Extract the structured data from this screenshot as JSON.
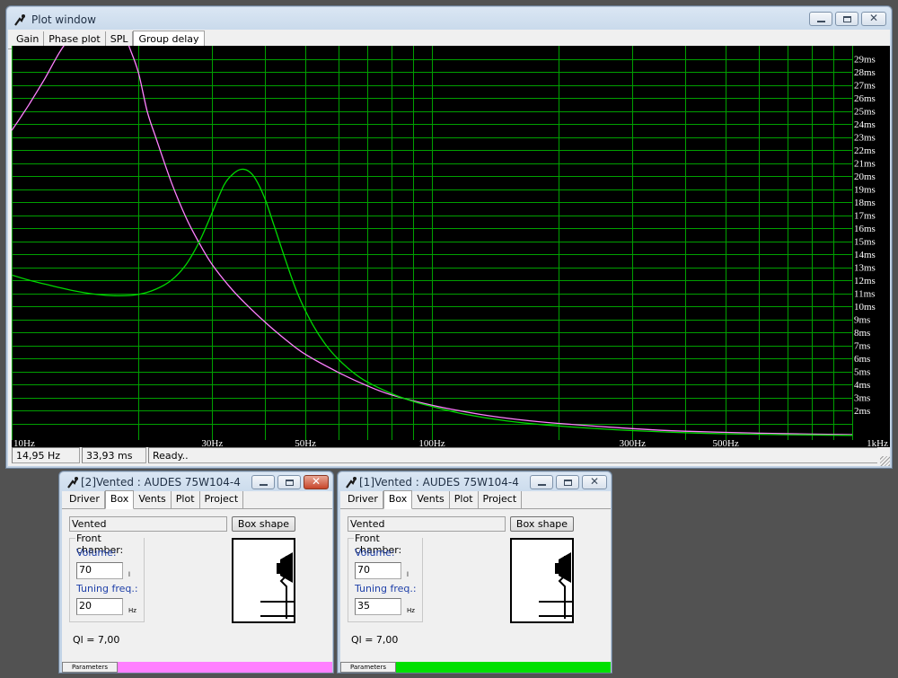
{
  "plot_window": {
    "title": "Plot window",
    "tabs": [
      {
        "label": "Gain",
        "active": false
      },
      {
        "label": "Phase plot",
        "active": false
      },
      {
        "label": "SPL",
        "active": false
      },
      {
        "label": "Group delay",
        "active": true
      }
    ],
    "status": {
      "freq": "14,95 Hz",
      "delay": "33,93 ms",
      "message": "Ready.."
    }
  },
  "chart_data": {
    "type": "line",
    "x_scale": "log",
    "xlim": [
      10,
      1000
    ],
    "ylim": [
      0,
      30
    ],
    "grid": true,
    "x_tick_labels": [
      {
        "x": 10,
        "label": "10Hz"
      },
      {
        "x": 30,
        "label": "30Hz"
      },
      {
        "x": 50,
        "label": "50Hz"
      },
      {
        "x": 100,
        "label": "100Hz"
      },
      {
        "x": 300,
        "label": "300Hz"
      },
      {
        "x": 500,
        "label": "500Hz"
      },
      {
        "x": 1000,
        "label": "1kHz"
      }
    ],
    "y_ticks": [
      2,
      3,
      4,
      5,
      6,
      7,
      8,
      9,
      10,
      11,
      12,
      13,
      14,
      15,
      16,
      17,
      18,
      19,
      20,
      21,
      22,
      23,
      24,
      25,
      26,
      27,
      28,
      29
    ],
    "y_tick_suffix": "ms",
    "series": [
      {
        "color": "#ff80ff",
        "x": [
          10,
          10.5,
          11,
          12,
          13,
          14,
          15.5,
          17,
          18,
          19,
          20,
          21,
          22,
          24,
          26,
          28,
          30,
          33,
          36,
          40,
          45,
          50,
          60,
          70,
          80,
          100,
          130,
          160,
          200,
          300,
          400,
          600,
          800,
          1000
        ],
        "y": [
          23.5,
          24.5,
          25.5,
          27.5,
          29.5,
          31,
          33,
          33,
          32,
          30,
          28,
          25,
          23,
          19.5,
          16.8,
          14.8,
          13.2,
          11.5,
          10.2,
          8.8,
          7.4,
          6.3,
          4.9,
          3.9,
          3.2,
          2.4,
          1.7,
          1.3,
          1.0,
          0.6,
          0.4,
          0.25,
          0.18,
          0.14
        ]
      },
      {
        "color": "#00d800",
        "x": [
          10,
          11,
          12,
          14,
          16,
          18,
          20,
          22,
          24,
          26,
          28,
          30,
          32,
          33.5,
          35,
          36.5,
          38,
          40,
          42,
          45,
          48,
          52,
          56,
          60,
          65,
          70,
          80,
          90,
          100,
          120,
          150,
          200,
          300,
          500,
          1000
        ],
        "y": [
          12.4,
          12.0,
          11.7,
          11.2,
          10.9,
          10.8,
          10.9,
          11.3,
          12.0,
          13.2,
          15.0,
          17.2,
          19.3,
          20.1,
          20.5,
          20.4,
          19.8,
          18.3,
          16.3,
          13.4,
          10.9,
          8.6,
          7.0,
          5.9,
          4.9,
          4.2,
          3.3,
          2.7,
          2.3,
          1.7,
          1.2,
          0.8,
          0.45,
          0.2,
          0.08
        ]
      }
    ]
  },
  "vented_windows": [
    {
      "title": "[2]Vented : AUDES 75W104-4",
      "close_style": "red",
      "tabs": [
        {
          "label": "Driver",
          "active": false
        },
        {
          "label": "Box",
          "active": true
        },
        {
          "label": "Vents",
          "active": false
        },
        {
          "label": "Plot",
          "active": false
        },
        {
          "label": "Project",
          "active": false
        }
      ],
      "box_type": "Vented",
      "box_shape_label": "Box shape",
      "group_title": "Front chamber:",
      "volume_label": "Volume:",
      "volume_value": "70",
      "volume_unit": "l",
      "tuning_label": "Tuning freq.:",
      "tuning_value": "20",
      "tuning_unit": "Hz",
      "ql": "Ql = 7,00",
      "params_label": "Parameters",
      "color": "#ff80ff"
    },
    {
      "title": "[1]Vented : AUDES 75W104-4",
      "close_style": "normal",
      "tabs": [
        {
          "label": "Driver",
          "active": false
        },
        {
          "label": "Box",
          "active": true
        },
        {
          "label": "Vents",
          "active": false
        },
        {
          "label": "Plot",
          "active": false
        },
        {
          "label": "Project",
          "active": false
        }
      ],
      "box_type": "Vented",
      "box_shape_label": "Box shape",
      "group_title": "Front chamber:",
      "volume_label": "Volume:",
      "volume_value": "70",
      "volume_unit": "l",
      "tuning_label": "Tuning freq.:",
      "tuning_value": "35",
      "tuning_unit": "Hz",
      "ql": "Ql = 7,00",
      "params_label": "Parameters",
      "color": "#00e000"
    }
  ]
}
